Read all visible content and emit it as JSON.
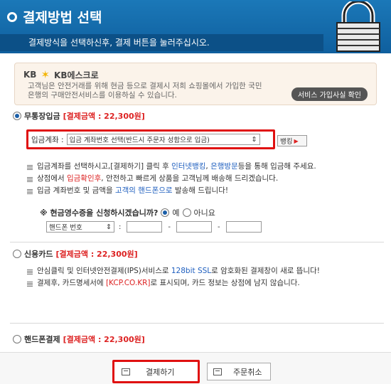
{
  "header": {
    "title": "결제방법 선택",
    "subtitle": "결제방식을 선택하신후, 결제 버튼을 눌러주십시오."
  },
  "kb": {
    "left_label": "KB",
    "brand": "KB에스크로",
    "desc": "고객님은 안전거래를 위해 현금 등으로 결제시 저희 쇼핑몰에서 가입한 국민은행의 구매안전서비스를 이용하실 수 있습니다.",
    "button": "서비스 가입사실 확인"
  },
  "bank_transfer": {
    "label": "무통장입금",
    "amount": "[결제금액 : 22,300원]",
    "account_label": "입금계좌 :",
    "account_select": "입금 계좌번호 선택(반드시 주문자 성함으로 입금)",
    "bank_btn": "뱅킹",
    "notes": [
      {
        "a": "입금계좌를 선택하시고,[결제하기] 클릭 후 ",
        "b": "인터넷뱅킹",
        "c": ", ",
        "d": "은행방문",
        "e": "등을 통해 입금해 주세요."
      },
      {
        "a": "상점에서 ",
        "b": "입금확인후",
        "c": ", 안전하고 빠르게 상품을 고객님께 배송해 드리겠습니다."
      },
      {
        "a": "입금 계좌번호 및 금액을 ",
        "b": "고객의 핸드폰으로",
        "c": " 발송해 드립니다!"
      }
    ],
    "receipt_q": "※ 현금영수증을 신청하시겠습니까?",
    "yes": "예",
    "no": "아니요",
    "phone_select": "핸드폰 번호",
    "dash": "-"
  },
  "card": {
    "label": "신용카드",
    "amount": "[결제금액 : 22,300원]",
    "notes": [
      {
        "a": "안심클릭 및 인터넷안전결제(IPS)서비스로 ",
        "b": "128bit SSL",
        "c": "로 암호화된 결제창이 새로 뜹니다!"
      },
      {
        "a": "결제후, 카드명세서에 ",
        "b": "[KCP.CO.KR]",
        "c": "로 표시되며, 카드 정보는 상점에 남지 않습니다."
      }
    ]
  },
  "phone_pay": {
    "label": "핸드폰결제",
    "amount": "[결제금액 : 22,300원]"
  },
  "buttons": {
    "pay": "결제하기",
    "cancel": "주문취소"
  },
  "colors": {
    "header": "#1b78b8",
    "accent_red": "#d22222",
    "link_blue": "#1f5fbf"
  }
}
